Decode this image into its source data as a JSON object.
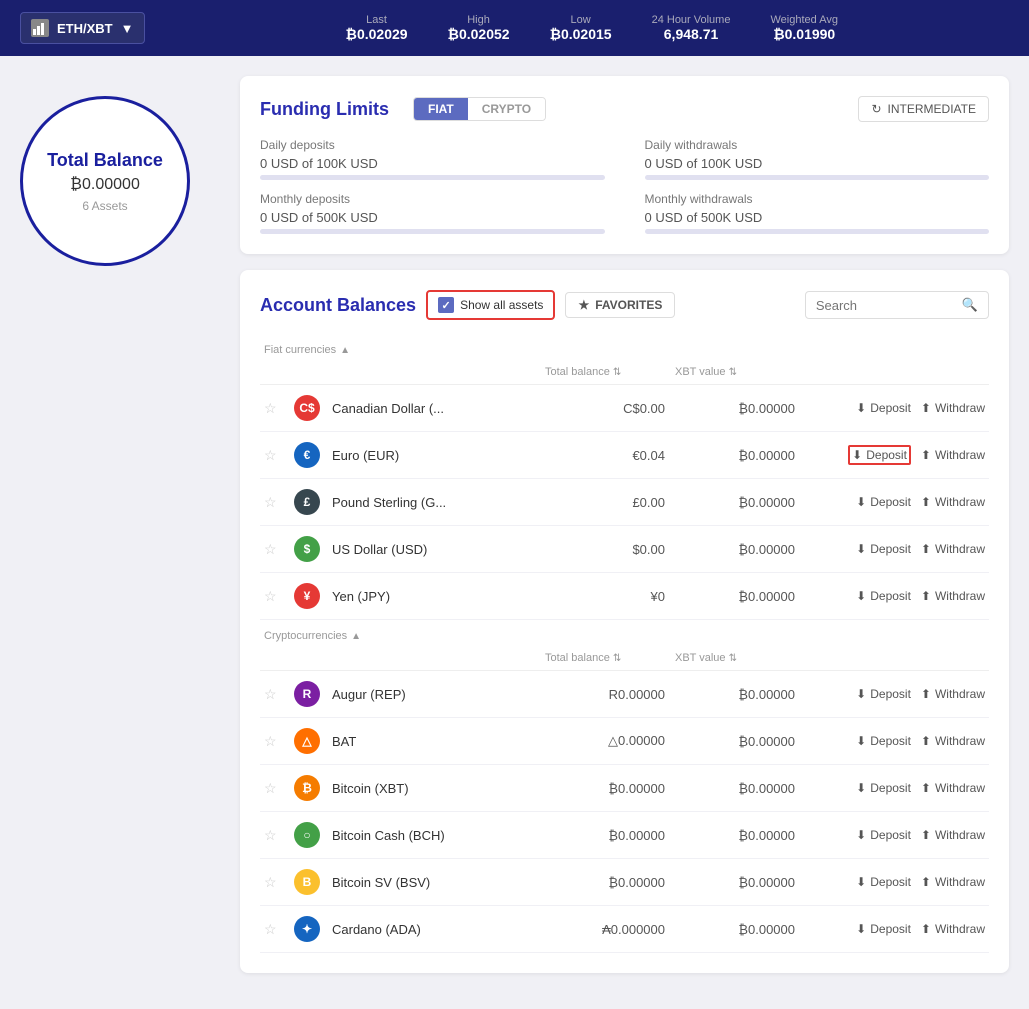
{
  "header": {
    "ticker": "ETH/XBT",
    "stats": [
      {
        "label": "Last",
        "value": "₿0.02029"
      },
      {
        "label": "High",
        "value": "₿0.02052"
      },
      {
        "label": "Low",
        "value": "₿0.02015"
      },
      {
        "label": "24 Hour Volume",
        "value": "6,948.71"
      },
      {
        "label": "Weighted Avg",
        "value": "₿0.01990"
      }
    ]
  },
  "balance": {
    "label": "Total Balance",
    "value": "₿0.00000",
    "assets": "6 Assets"
  },
  "funding": {
    "title": "Funding Limits",
    "tab_fiat": "FIAT",
    "tab_crypto": "CRYPTO",
    "intermediate_label": "INTERMEDIATE",
    "rows": [
      {
        "label": "Daily deposits",
        "value": "0 USD of 100K USD",
        "progress": 0
      },
      {
        "label": "Daily withdrawals",
        "value": "0 USD of 100K USD",
        "progress": 0
      },
      {
        "label": "Monthly deposits",
        "value": "0 USD of 500K USD",
        "progress": 0
      },
      {
        "label": "Monthly withdrawals",
        "value": "0 USD of 500K USD",
        "progress": 0
      }
    ]
  },
  "balances": {
    "title": "Account Balances",
    "show_all_label": "Show all assets",
    "favorites_label": "FAVORITES",
    "search_placeholder": "Search",
    "fiat_section": "Fiat currencies",
    "crypto_section": "Cryptocurrencies",
    "col_total": "Total balance",
    "col_xbt": "XBT value",
    "deposit_label": "Deposit",
    "withdraw_label": "Withdraw",
    "fiat_currencies": [
      {
        "name": "Canadian Dollar (...",
        "icon_color": "#e53935",
        "icon_text": "C$",
        "total": "C$0.00",
        "xbt": "₿0.00000",
        "highlight_deposit": false
      },
      {
        "name": "Euro (EUR)",
        "icon_color": "#1565c0",
        "icon_text": "€",
        "total": "€0.04",
        "xbt": "₿0.00000",
        "highlight_deposit": true
      },
      {
        "name": "Pound Sterling (G...",
        "icon_color": "#37474f",
        "icon_text": "£",
        "total": "£0.00",
        "xbt": "₿0.00000",
        "highlight_deposit": false
      },
      {
        "name": "US Dollar (USD)",
        "icon_color": "#43a047",
        "icon_text": "$",
        "total": "$0.00",
        "xbt": "₿0.00000",
        "highlight_deposit": false
      },
      {
        "name": "Yen (JPY)",
        "icon_color": "#e53935",
        "icon_text": "¥",
        "total": "¥0",
        "xbt": "₿0.00000",
        "highlight_deposit": false
      }
    ],
    "cryptocurrencies": [
      {
        "name": "Augur (REP)",
        "icon_color": "#7b1fa2",
        "icon_text": "R",
        "total": "R0.00000",
        "xbt": "₿0.00000",
        "highlight_deposit": false
      },
      {
        "name": "BAT",
        "icon_color": "#ff6f00",
        "icon_text": "△",
        "total": "△0.00000",
        "xbt": "₿0.00000",
        "highlight_deposit": false
      },
      {
        "name": "Bitcoin (XBT)",
        "icon_color": "#f57c00",
        "icon_text": "₿",
        "total": "₿0.00000",
        "xbt": "₿0.00000",
        "highlight_deposit": false
      },
      {
        "name": "Bitcoin Cash (BCH)",
        "icon_color": "#43a047",
        "icon_text": "○",
        "total": "₿0.00000",
        "xbt": "₿0.00000",
        "highlight_deposit": false
      },
      {
        "name": "Bitcoin SV (BSV)",
        "icon_color": "#fbc02d",
        "icon_text": "B",
        "total": "₿0.00000",
        "xbt": "₿0.00000",
        "highlight_deposit": false
      },
      {
        "name": "Cardano (ADA)",
        "icon_color": "#1565c0",
        "icon_text": "✦",
        "total": "₳0.000000",
        "xbt": "₿0.00000",
        "highlight_deposit": false
      }
    ]
  }
}
